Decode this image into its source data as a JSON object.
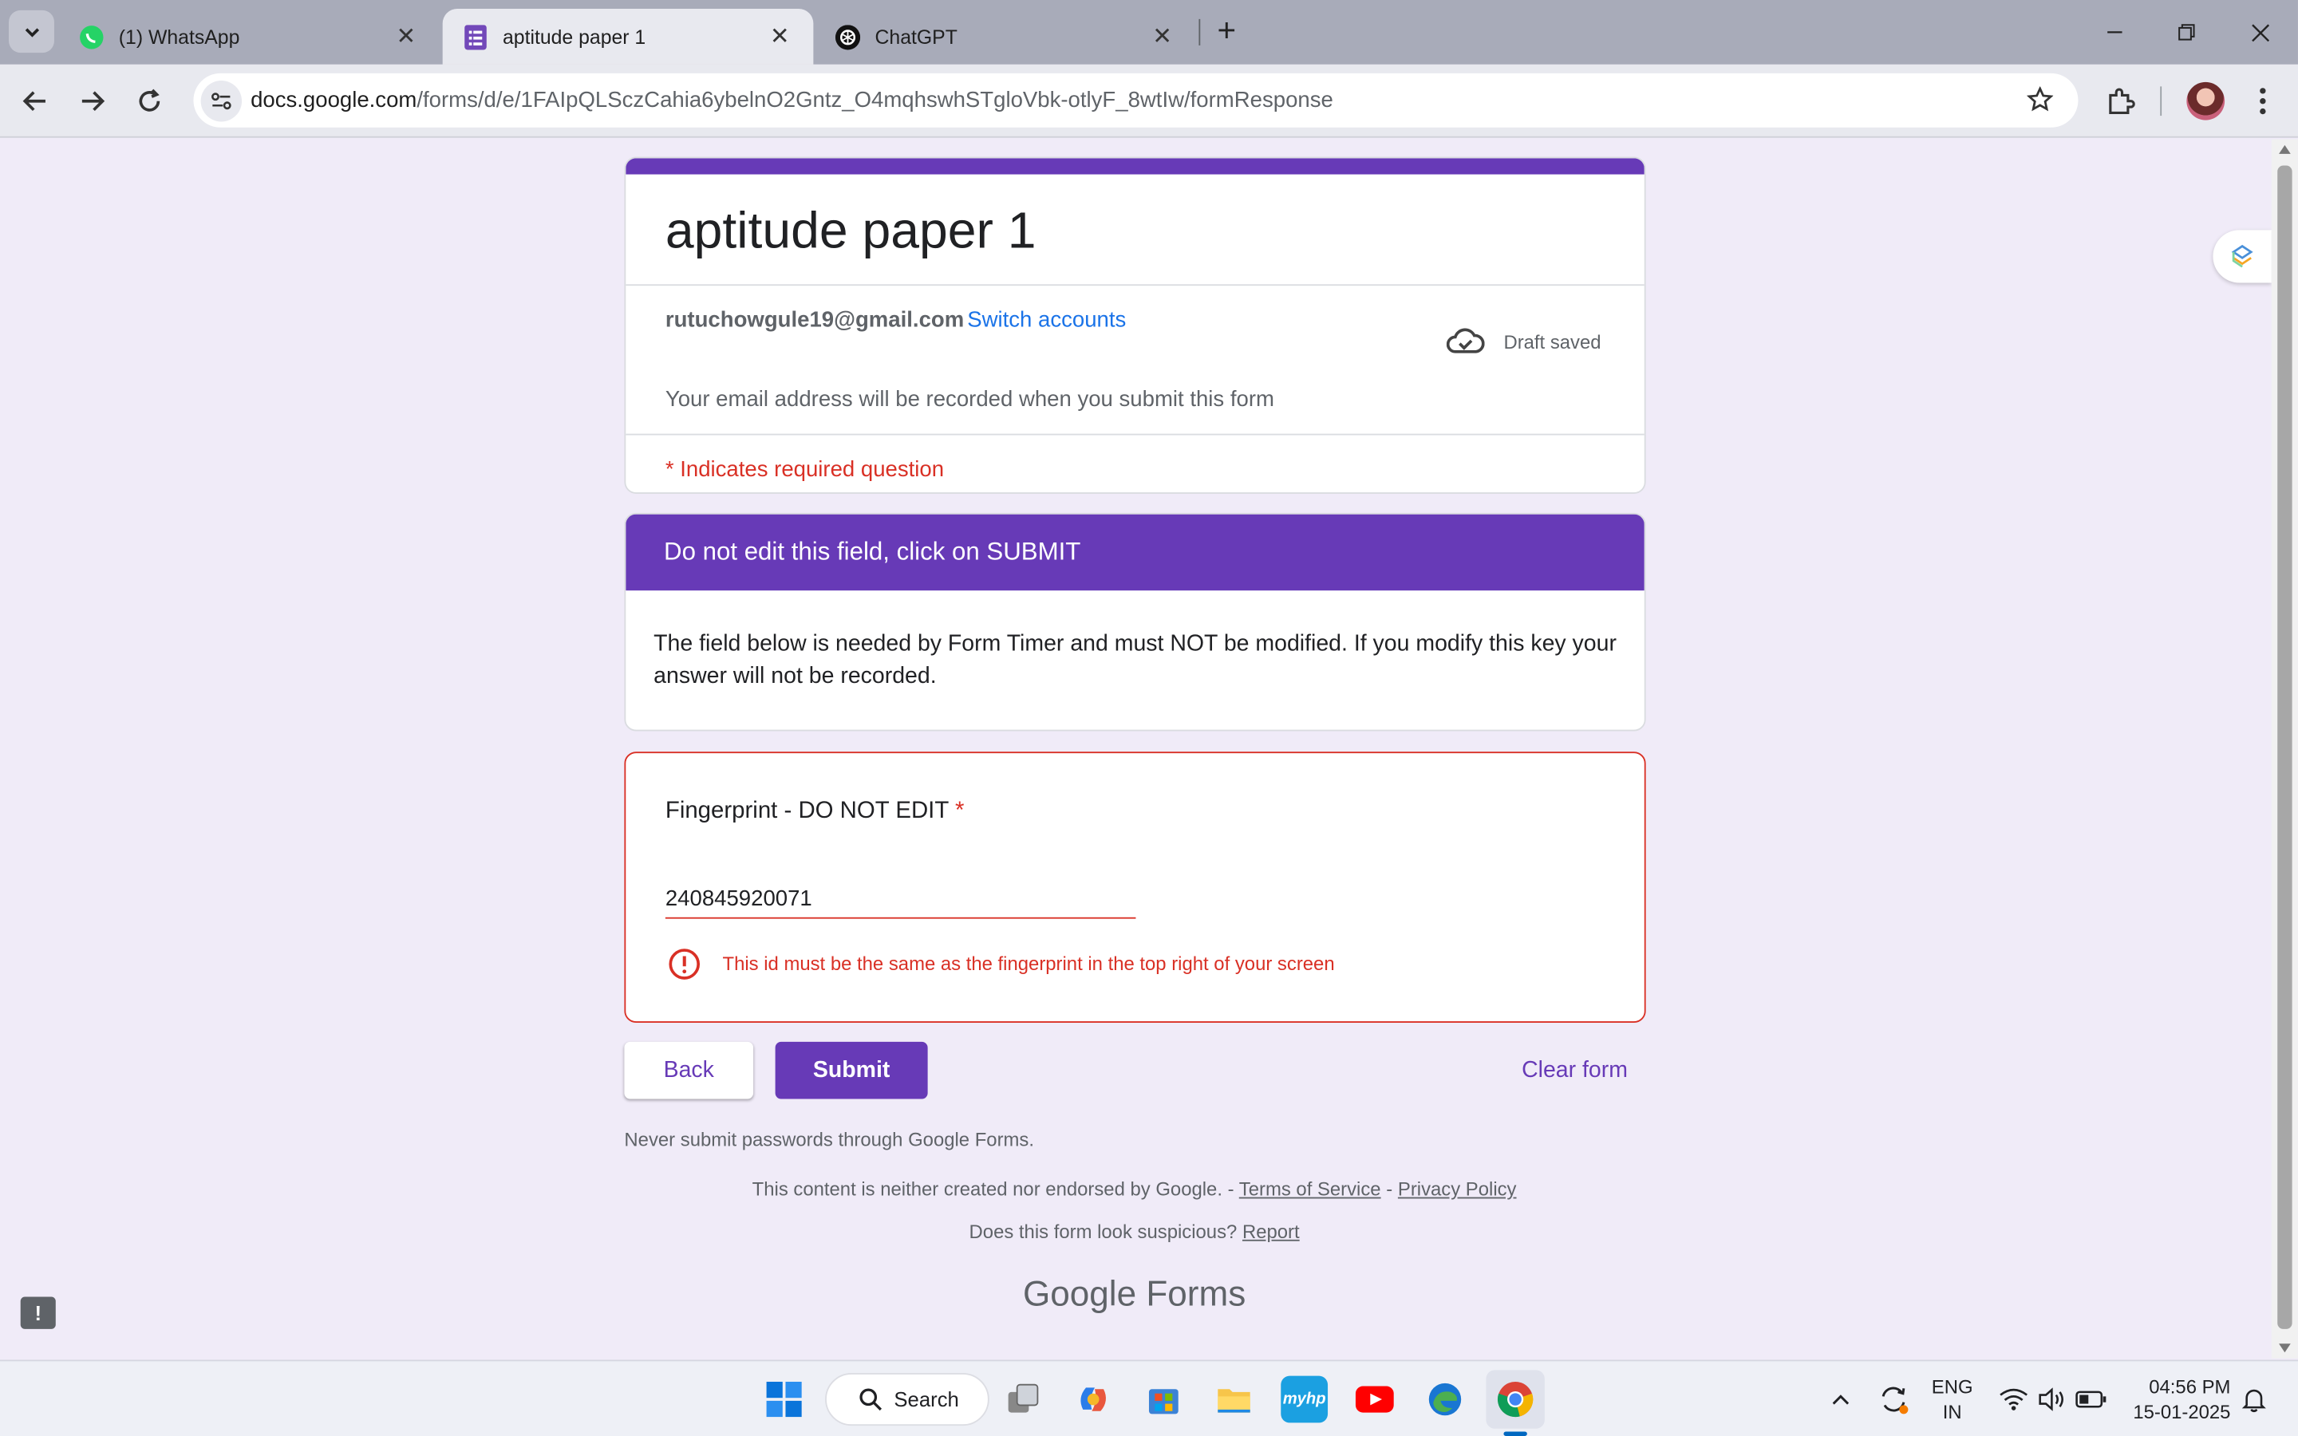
{
  "browser": {
    "tabs": [
      {
        "title": "(1) WhatsApp",
        "icon": "whatsapp-icon",
        "active": false
      },
      {
        "title": "aptitude paper 1",
        "icon": "google-forms-icon",
        "active": true
      },
      {
        "title": "ChatGPT",
        "icon": "chatgpt-icon",
        "active": false
      }
    ],
    "url_host": "docs.google.com",
    "url_path": "/forms/d/e/1FAIpQLSczCahia6ybelnO2Gntz_O4mqhswhSTgloVbk-otlyF_8wtIw/formResponse"
  },
  "form": {
    "title": "aptitude paper 1",
    "account_email": "rutuchowgule19@gmail.com",
    "switch_accounts": "Switch accounts",
    "draft_status": "Draft saved",
    "email_note": "Your email address will be recorded when you submit this form",
    "required_note": "* Indicates required question",
    "section_title": "Do not edit this field, click on SUBMIT",
    "section_description": "The field below is needed by Form Timer and must NOT be modified. If you modify this key your answer will not be recorded.",
    "question_title": "Fingerprint - DO NOT EDIT",
    "question_required_mark": "*",
    "question_value": "240845920071",
    "error_text": "This id must be the same as the fingerprint in the top right of your screen",
    "back_label": "Back",
    "submit_label": "Submit",
    "clear_label": "Clear form",
    "password_warning": "Never submit passwords through Google Forms.",
    "disclaimer": "This content is neither created nor endorsed by Google. -",
    "terms_label": "Terms of Service",
    "dash": "-",
    "privacy_label": "Privacy Policy",
    "suspicious_text": "Does this form look suspicious?",
    "report_label": "Report",
    "logo_google": "Google",
    "logo_forms": "Forms"
  },
  "taskbar": {
    "search_label": "Search",
    "language_line1": "ENG",
    "language_line2": "IN",
    "time": "04:56 PM",
    "date": "15-01-2025"
  },
  "colors": {
    "accent": "#673ab7",
    "error": "#d93025",
    "link": "#1a73e8",
    "page_bg": "#f0ebf8"
  }
}
